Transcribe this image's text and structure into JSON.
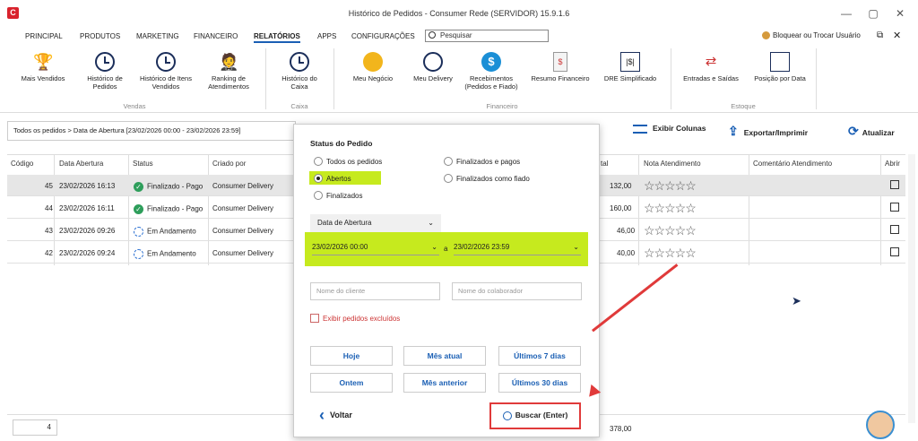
{
  "window": {
    "title": "Histórico de Pedidos - Consumer Rede (SERVIDOR) 15.9.1.6",
    "app_logo": "C",
    "minimize": "—",
    "maximize": "▢",
    "close": "✕"
  },
  "menu": {
    "items": [
      "PRINCIPAL",
      "PRODUTOS",
      "MARKETING",
      "FINANCEIRO",
      "RELATÓRIOS",
      "APPS",
      "CONFIGURAÇÕES"
    ],
    "active": "RELATÓRIOS",
    "search_placeholder": "Pesquisar",
    "lock_label": "Bloquear ou Trocar Usuário"
  },
  "ribbon": {
    "vendas": {
      "label": "Vendas",
      "buttons": [
        "Mais Vendidos",
        "Histórico de Pedidos",
        "Histórico de Itens Vendidos",
        "Ranking de Atendimentos"
      ]
    },
    "caixa": {
      "label": "Caixa",
      "buttons": [
        "Histórico do Caixa"
      ]
    },
    "financeiro": {
      "label": "Financeiro",
      "buttons": [
        "Meu Negócio",
        "Meu Delivery",
        "Recebimentos (Pedidos e Fiado)",
        "Resumo Financeiro",
        "DRE Simplificado"
      ]
    },
    "estoque": {
      "label": "Estoque",
      "buttons": [
        "Entradas e Saídas",
        "Posição por Data"
      ]
    }
  },
  "toolbar": {
    "breadcrumb": "Todos os pedidos > Data de Abertura [23/02/2026 00:00 - 23/02/2026 23:59]",
    "columns_label": "Exibir Colunas",
    "export_label": "Exportar/Imprimir",
    "refresh_label": "Atualizar"
  },
  "table": {
    "headers": [
      "Código",
      "Data Abertura",
      "Status",
      "Criado por",
      "tal",
      "Nota Atendimento",
      "Comentário Atendimento",
      "Abrir"
    ],
    "rows": [
      {
        "codigo": "45",
        "data": "23/02/2026 16:13",
        "status": "Finalizado - Pago",
        "criado_por": "Consumer Delivery",
        "total": "132,00",
        "status_type": "ok"
      },
      {
        "codigo": "44",
        "data": "23/02/2026 16:11",
        "status": "Finalizado - Pago",
        "criado_por": "Consumer Delivery",
        "total": "160,00",
        "status_type": "ok"
      },
      {
        "codigo": "43",
        "data": "23/02/2026 09:26",
        "status": "Em Andamento",
        "criado_por": "Consumer Delivery",
        "total": "46,00",
        "status_type": "progress"
      },
      {
        "codigo": "42",
        "data": "23/02/2026 09:24",
        "status": "Em Andamento",
        "criado_por": "Consumer Delivery",
        "total": "40,00",
        "status_type": "progress"
      }
    ],
    "stars": "☆☆☆☆☆",
    "footer_count": "4",
    "footer_total": "378,00"
  },
  "modal": {
    "title": "Status do Pedido",
    "options": {
      "todos": "Todos os pedidos",
      "abertos": "Abertos",
      "finalizados": "Finalizados",
      "finalizados_pagos": "Finalizados e pagos",
      "finalizados_fiado": "Finalizados como fiado"
    },
    "selected": "abertos",
    "date_type": "Data de Abertura",
    "date_from": "23/02/2026 00:00",
    "date_sep": "a",
    "date_to": "23/02/2026 23:59",
    "client_placeholder": "Nome do cliente",
    "collab_placeholder": "Nome do colaborador",
    "show_deleted": "Exibir pedidos excluídos",
    "quick": [
      "Hoje",
      "Mês atual",
      "Últimos 7 dias",
      "Ontem",
      "Mês anterior",
      "Últimos 30 dias"
    ],
    "back_label": "Voltar",
    "search_label": "Buscar (Enter)"
  },
  "colors": {
    "highlight": "#c6ea1e",
    "accent": "#1a5fb4",
    "annotation": "#e03a3a",
    "status_ok": "#2e9e5b"
  }
}
